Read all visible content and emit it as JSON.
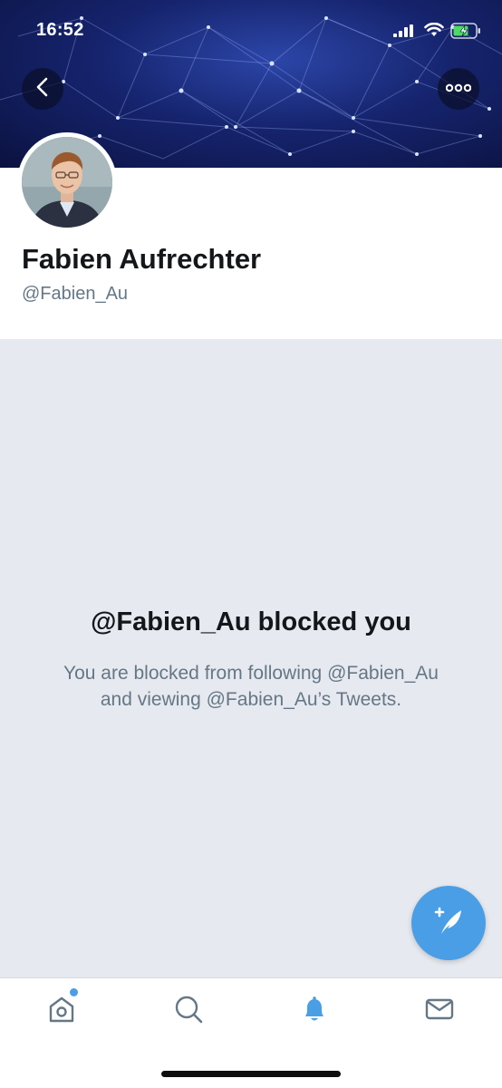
{
  "status_bar": {
    "time": "16:52"
  },
  "header": {
    "back_icon": "chevron-left-icon",
    "more_icon": "ellipsis-icon"
  },
  "profile": {
    "name": "Fabien Aufrechter",
    "handle": "@Fabien_Au"
  },
  "blocked": {
    "title": "@Fabien_Au blocked you",
    "message": "You are blocked from following @Fabien_Au and viewing @Fabien_Au’s Tweets."
  },
  "fab": {
    "icon": "compose-tweet-icon"
  },
  "tab_bar": {
    "items": [
      {
        "name": "home",
        "icon": "home-icon",
        "active": false,
        "has_badge": true
      },
      {
        "name": "search",
        "icon": "search-icon",
        "active": false
      },
      {
        "name": "notifications",
        "icon": "bell-icon",
        "active": true
      },
      {
        "name": "messages",
        "icon": "mail-icon",
        "active": false
      }
    ]
  },
  "colors": {
    "accent": "#4a9ee6",
    "text_primary": "#14171a",
    "text_secondary": "#657786",
    "blocked_background": "#e6e9ef"
  }
}
